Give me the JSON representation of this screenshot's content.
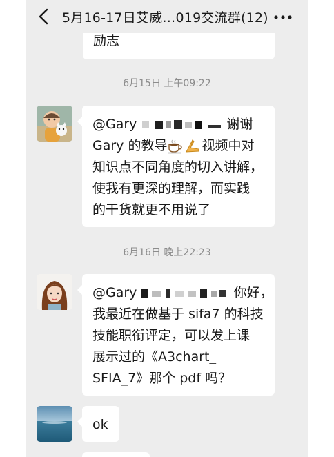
{
  "header": {
    "title": "5月16-17日艾威…019交流群(12)",
    "back_icon": "chevron-left-icon",
    "more_icon": "more-dots-icon"
  },
  "messages": [
    {
      "type": "text",
      "lines": [
        "励志"
      ]
    },
    {
      "type": "timestamp",
      "text": "6月15日 上午09:22"
    },
    {
      "type": "text",
      "avatar": "baby-avatar",
      "mention": "@Gary",
      "after_mask": "谢谢",
      "lines": [
        "Gary 的教导",
        "视频中对",
        "知识点不同角度的切入讲解，",
        "使我有更深的理解，而实践",
        "的干货就更不用说了"
      ],
      "emojis": [
        "coffee-icon",
        "hands-icon"
      ]
    },
    {
      "type": "timestamp",
      "text": "6月16日 晚上22:23"
    },
    {
      "type": "text",
      "avatar": "woman-avatar",
      "mention": "@Gary",
      "after_mask": "你好，",
      "lines": [
        "我最近在做基于 sifa7 的科技",
        "技能职衔评定，可以发上课",
        "展示过的《A3chart_",
        "SFIA_7》那个 pdf 吗？"
      ]
    },
    {
      "type": "text",
      "avatar": "ocean-avatar",
      "lines": [
        "ok"
      ]
    }
  ],
  "colors": {
    "background": "#ededed",
    "bubble": "#ffffff",
    "text": "#191919",
    "timestamp": "#8c8c8c"
  }
}
